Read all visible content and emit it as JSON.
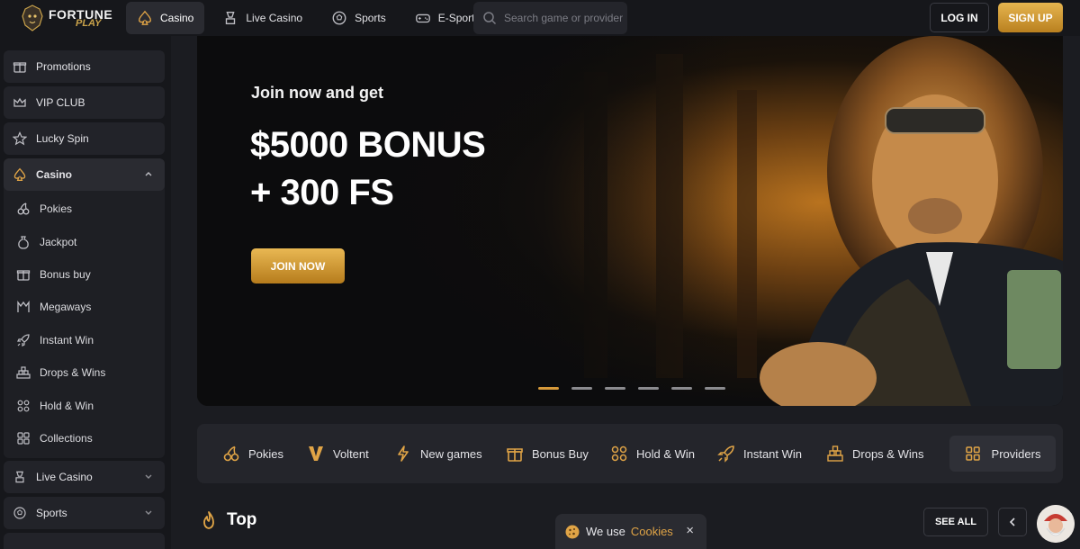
{
  "header": {
    "logo": {
      "line1": "FORTUNE",
      "line2": "PLAY"
    },
    "nav": [
      {
        "label": "Casino",
        "icon": "spade-icon",
        "active": true
      },
      {
        "label": "Live Casino",
        "icon": "roulette-icon",
        "active": false
      },
      {
        "label": "Sports",
        "icon": "soccer-ball-icon",
        "active": false
      },
      {
        "label": "E-Sports",
        "icon": "gamepad-icon",
        "active": false
      }
    ],
    "search_placeholder": "Search game or provider",
    "login_label": "LOG IN",
    "signup_label": "SIGN UP"
  },
  "sidebar": {
    "items": [
      {
        "label": "Promotions",
        "icon": "gift-icon"
      },
      {
        "label": "VIP CLUB",
        "icon": "crown-icon"
      },
      {
        "label": "Lucky Spin",
        "icon": "star-icon"
      }
    ],
    "casino": {
      "label": "Casino",
      "expanded": true,
      "subitems": [
        {
          "label": "Pokies",
          "icon": "cherries-icon"
        },
        {
          "label": "Jackpot",
          "icon": "money-bag-icon"
        },
        {
          "label": "Bonus buy",
          "icon": "gift-icon"
        },
        {
          "label": "Megaways",
          "icon": "megaways-icon"
        },
        {
          "label": "Instant Win",
          "icon": "rocket-icon"
        },
        {
          "label": "Drops & Wins",
          "icon": "pyramid-icon"
        },
        {
          "label": "Hold & Win",
          "icon": "coins-icon"
        },
        {
          "label": "Collections",
          "icon": "grid-icon"
        }
      ]
    },
    "bottom": [
      {
        "label": "Live Casino",
        "icon": "roulette-icon"
      },
      {
        "label": "Sports",
        "icon": "soccer-ball-icon"
      }
    ]
  },
  "banner": {
    "join_text": "Join now and get",
    "bonus_line1": "$5000 BONUS",
    "bonus_line2": "+ 300 FS",
    "button_label": "JOIN NOW",
    "slides_count": 6,
    "active_slide": 0,
    "accent": "#d79a3a"
  },
  "categories": [
    {
      "label": "Pokies",
      "icon": "cherries-icon"
    },
    {
      "label": "Voltent",
      "icon": "voltent-v-icon"
    },
    {
      "label": "New games",
      "icon": "lightning-icon"
    },
    {
      "label": "Bonus Buy",
      "icon": "gift-icon"
    },
    {
      "label": "Hold & Win",
      "icon": "coins-icon"
    },
    {
      "label": "Instant Win",
      "icon": "rocket-icon"
    },
    {
      "label": "Drops & Wins",
      "icon": "pyramid-icon"
    },
    {
      "label": "Providers",
      "icon": "grid-icon"
    }
  ],
  "top_section": {
    "title": "Top",
    "icon": "flame-icon",
    "see_all_label": "SEE ALL"
  },
  "cookie": {
    "prefix": "We use",
    "link": "Cookies",
    "close": "×"
  },
  "colors": {
    "gold": "#e0a446",
    "background": "#1b1c21"
  }
}
